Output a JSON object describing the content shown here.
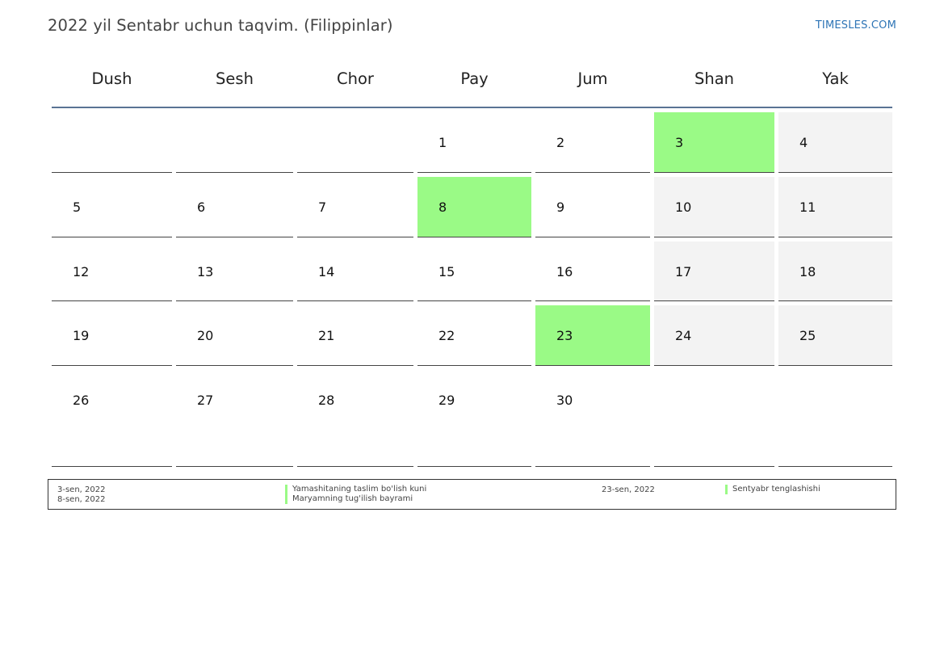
{
  "header": {
    "title": "2022 yil Sentabr uchun taqvim. (Filippinlar)",
    "site": "TIMESLES.COM"
  },
  "weekdays": [
    "Dush",
    "Sesh",
    "Chor",
    "Pay",
    "Jum",
    "Shan",
    "Yak"
  ],
  "weeks": [
    [
      "",
      "",
      "",
      "1",
      "2",
      "3",
      "4"
    ],
    [
      "5",
      "6",
      "7",
      "8",
      "9",
      "10",
      "11"
    ],
    [
      "12",
      "13",
      "14",
      "15",
      "16",
      "17",
      "18"
    ],
    [
      "19",
      "20",
      "21",
      "22",
      "23",
      "24",
      "25"
    ],
    [
      "26",
      "27",
      "28",
      "29",
      "30",
      "",
      ""
    ]
  ],
  "holidays": [
    {
      "date": "3-sen, 2022",
      "name": "Yamashitaning taslim bo'lish kuni",
      "day": "3"
    },
    {
      "date": "8-sen, 2022",
      "name": "Maryamning tug'ilish bayrami",
      "day": "8"
    },
    {
      "date": "23-sen, 2022",
      "name": "Sentyabr tenglashishi",
      "day": "23"
    }
  ],
  "colors": {
    "holiday": "#9afa86",
    "weekend": "#f3f3f3",
    "header_rule": "#5a7394",
    "site_link": "#2e75b6"
  }
}
